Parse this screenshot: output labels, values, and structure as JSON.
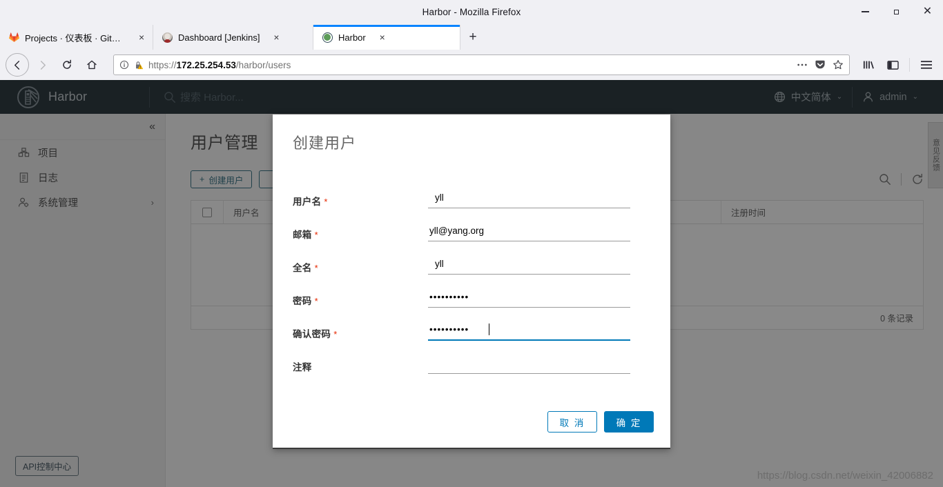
{
  "browser": {
    "window_title": "Harbor - Mozilla Firefox",
    "window_buttons": {
      "minimize": "minimize-button",
      "maximize": "maximize-button",
      "close": "close-button"
    },
    "tabs": [
      {
        "label": "Projects · 仪表板 · GitLab",
        "favicon": "gitlab-icon",
        "active": false,
        "close": "×"
      },
      {
        "label": "Dashboard [Jenkins]",
        "favicon": "jenkins-icon",
        "active": false,
        "close": "×"
      },
      {
        "label": "Harbor",
        "favicon": "harbor-icon",
        "active": true,
        "close": "×"
      }
    ],
    "new_tab_label": "+",
    "url": {
      "scheme": "https://",
      "host": "172.25.254.53",
      "path": "/harbor/users"
    },
    "nav": {
      "back": "‹",
      "forward": "›",
      "reload": "⟳",
      "home": "⌂"
    },
    "urlbar_icons": [
      "page-info-icon",
      "insecure-lock-warning-icon",
      "page-actions-icon",
      "pocket-icon",
      "bookmark-star-icon"
    ],
    "toolbar_icons": [
      "library-icon",
      "sidebar-icon",
      "hamburger-menu-icon"
    ]
  },
  "harbor": {
    "brand": "Harbor",
    "search_placeholder": "搜索 Harbor...",
    "language": "中文简体",
    "user": "admin",
    "sidebar": {
      "collapse_label": "«",
      "items": [
        {
          "label": "项目",
          "icon": "projects-icon",
          "chevron": ""
        },
        {
          "label": "日志",
          "icon": "logs-icon",
          "chevron": ""
        },
        {
          "label": "系统管理",
          "icon": "administration-icon",
          "chevron": "›"
        }
      ],
      "api_badge": "API控制中心"
    },
    "page_title": "用户管理",
    "toolbar": {
      "create_user_label": "创建用户",
      "create_user_plus": "+",
      "search_icon": "search-icon",
      "refresh_icon": "refresh-icon"
    },
    "table": {
      "columns": [
        "用户名",
        "注册时间"
      ],
      "rows": [],
      "footer_count": "0 条记录"
    },
    "side_tab_label": "意见反馈",
    "watermark": "https://blog.csdn.net/weixin_42006882"
  },
  "modal": {
    "title": "创建用户",
    "fields": [
      {
        "label": "用户名",
        "required": "*",
        "value": "yll",
        "placeholder": "",
        "focused": false,
        "type": "text"
      },
      {
        "label": "邮箱",
        "required": "*",
        "value": "yll@yang.org",
        "placeholder": "",
        "focused": false,
        "type": "text"
      },
      {
        "label": "全名",
        "required": "*",
        "value": "yll",
        "placeholder": "",
        "focused": false,
        "type": "text"
      },
      {
        "label": "密码",
        "required": "*",
        "value": "••••••••••",
        "placeholder": "",
        "focused": false,
        "type": "password"
      },
      {
        "label": "确认密码",
        "required": "*",
        "value": "••••••••••",
        "placeholder": "",
        "focused": true,
        "type": "password"
      },
      {
        "label": "注释",
        "required": "",
        "value": "",
        "placeholder": "",
        "focused": false,
        "type": "text"
      }
    ],
    "cancel_label": "取 消",
    "confirm_label": "确 定"
  },
  "colors": {
    "harbor_header": "#313d44",
    "accent_blue": "#0079b8",
    "required_red": "#e62700",
    "tab_active_indicator": "#0a84ff"
  }
}
